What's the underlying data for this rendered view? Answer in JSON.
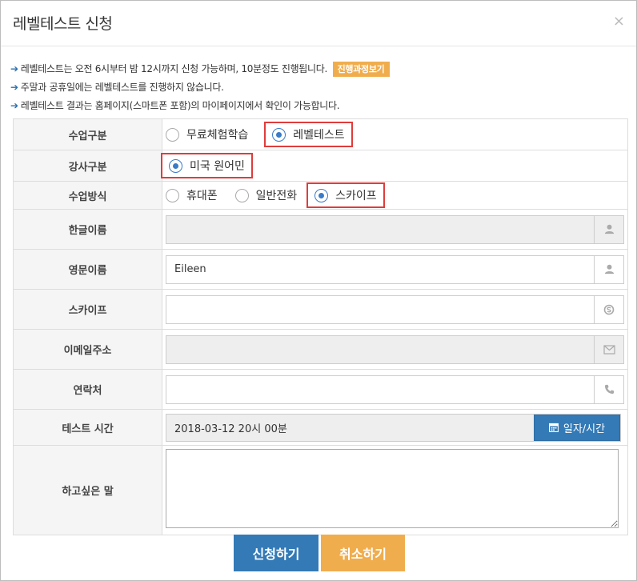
{
  "modal": {
    "title": "레벨테스트 신청",
    "close": "×"
  },
  "notices": [
    {
      "text": "레벨테스트는 오전 6시부터 밤 12시까지 신청 가능하며, 10분정도 진행됩니다.",
      "button": "진행과정보기"
    },
    {
      "text": "주말과 공휴일에는 레벨테스트를 진행하지 않습니다."
    },
    {
      "text": "레벨테스트 결과는 홈페이지(스마트폰 포함)의 마이페이지에서 확인이 가능합니다."
    }
  ],
  "form": {
    "class_type": {
      "label": "수업구분",
      "options": [
        "무료체험학습",
        "레벨테스트"
      ],
      "selected": "레벨테스트"
    },
    "teacher_type": {
      "label": "강사구분",
      "options": [
        "미국 원어민"
      ],
      "selected": "미국 원어민"
    },
    "class_method": {
      "label": "수업방식",
      "options": [
        "휴대폰",
        "일반전화",
        "스카이프"
      ],
      "selected": "스카이프"
    },
    "korean_name": {
      "label": "한글이름",
      "value": ""
    },
    "english_name": {
      "label": "영문이름",
      "value": "Eileen"
    },
    "skype": {
      "label": "스카이프",
      "value": ""
    },
    "email": {
      "label": "이메일주소",
      "value": ""
    },
    "contact": {
      "label": "연락처",
      "value": ""
    },
    "test_time": {
      "label": "테스트 시간",
      "value": "2018-03-12 20시 00분",
      "button": "일자/시간"
    },
    "message": {
      "label": "하고싶은 말",
      "value": ""
    }
  },
  "actions": {
    "submit": "신청하기",
    "cancel": "취소하기"
  },
  "colors": {
    "primary": "#337ab7",
    "warning": "#f0ad4e",
    "highlight": "#e03c3c",
    "radio": "#3a7bc8"
  }
}
